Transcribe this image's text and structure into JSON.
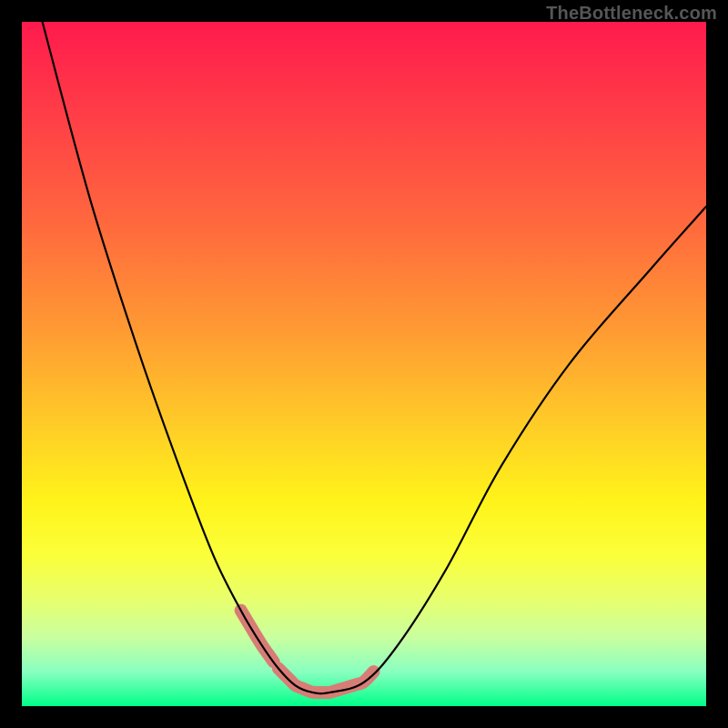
{
  "domain": "Chart",
  "watermark": "TheBottleneck.com",
  "colors": {
    "background": "#000000",
    "gradient_top": "#ff1a4d",
    "gradient_bottom": "#00ff88",
    "curve_stroke": "#000000",
    "highlight_stroke": "#d87d76"
  },
  "chart_data": {
    "type": "line",
    "title": "",
    "xlabel": "",
    "ylabel": "",
    "xlim": [
      0,
      100
    ],
    "ylim": [
      0,
      100
    ],
    "grid": false,
    "legend": false,
    "note": "x/y are image-space percentages; y=100 at top of plot, y=0 at bottom.",
    "series": [
      {
        "name": "curve",
        "x": [
          3,
          10,
          17,
          23,
          28,
          32,
          35,
          37.5,
          40,
          42.5,
          45,
          50,
          55,
          62,
          70,
          80,
          92,
          100
        ],
        "y": [
          100,
          74,
          52,
          35,
          22,
          14,
          9,
          5.5,
          3,
          2,
          2,
          3.5,
          9,
          20,
          35,
          50,
          64,
          73
        ]
      }
    ],
    "highlight_segments": [
      {
        "name": "left-descent",
        "x_range": [
          32,
          37.5
        ]
      },
      {
        "name": "valley-floor",
        "x_range": [
          37.5,
          45
        ]
      },
      {
        "name": "right-ascent",
        "x_range": [
          45,
          52
        ]
      }
    ]
  }
}
